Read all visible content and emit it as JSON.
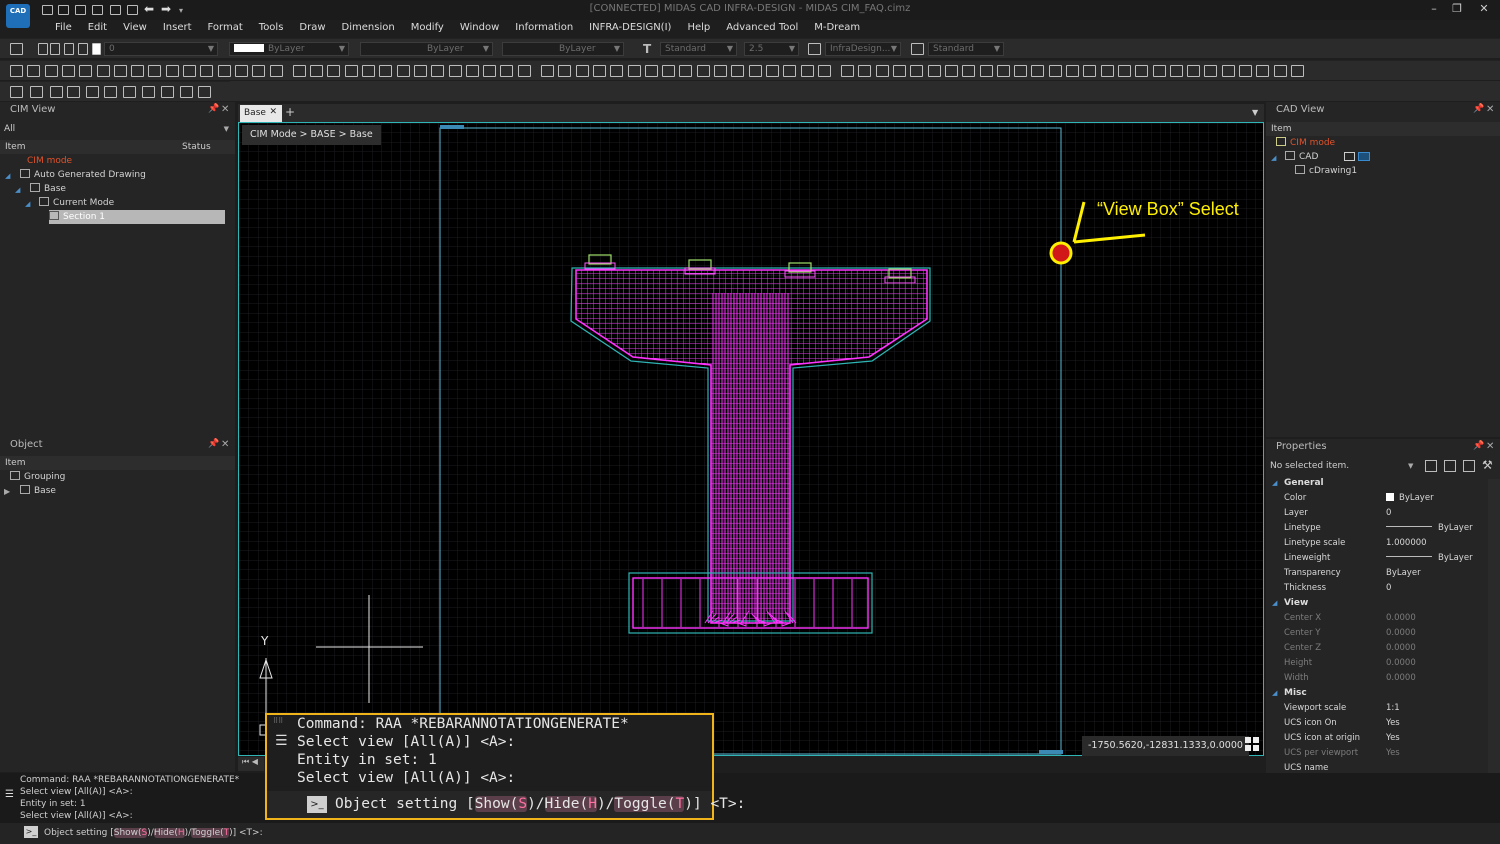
{
  "app": {
    "logo": "CAD",
    "title": "[CONNECTED] MIDAS CAD INFRA-DESIGN - MIDAS CIM_FAQ.cimz",
    "window_buttons": [
      "–",
      "❐",
      "✕"
    ]
  },
  "menu": [
    "File",
    "Edit",
    "View",
    "Insert",
    "Format",
    "Tools",
    "Draw",
    "Dimension",
    "Modify",
    "Window",
    "Information",
    "INFRA-DESIGN(I)",
    "Help",
    "Advanced Tool",
    "M-Dream"
  ],
  "layer_toolbar": {
    "layer_value": "0",
    "color_value": "ByLayer",
    "linetype_value": "ByLayer",
    "lineweight_value": "ByLayer",
    "textstyle_value": "Standard",
    "textsize_value": "2.5",
    "dimstyle_value": "InfraDesign...",
    "tablestyle_value": "Standard"
  },
  "cim_view": {
    "title": "CIM View",
    "filter_value": "All",
    "col_item": "Item",
    "col_status": "Status",
    "items": [
      {
        "label": "CIM mode",
        "color": "#e0532b"
      },
      {
        "label": "Auto Generated Drawing"
      },
      {
        "label": "Base"
      },
      {
        "label": "Current Mode"
      },
      {
        "label": "Section 1"
      }
    ]
  },
  "object_panel": {
    "title": "Object",
    "col_item": "Item",
    "items": [
      "Grouping",
      "Base"
    ]
  },
  "drawing_tabs": {
    "active": "Base",
    "add": "+"
  },
  "breadcrumb": "CIM Mode > BASE > Base",
  "annotation": {
    "text": "“View Box” Select",
    "color": "#ffef00"
  },
  "ucs": {
    "y_label": "Y"
  },
  "coordinate_readout": "-1750.5620,-12831.1333,0.0000",
  "cad_view": {
    "title": "CAD View",
    "col_item": "Item",
    "items": [
      "CIM mode",
      "CAD",
      "cDrawing1"
    ]
  },
  "properties": {
    "title": "Properties",
    "selection": "No selected item.",
    "categories": {
      "general": "General",
      "view": "View",
      "misc": "Misc"
    },
    "general": [
      {
        "k": "Color",
        "v": "ByLayer"
      },
      {
        "k": "Layer",
        "v": "0"
      },
      {
        "k": "Linetype",
        "v": "ByLayer"
      },
      {
        "k": "Linetype scale",
        "v": "1.000000"
      },
      {
        "k": "Lineweight",
        "v": "ByLayer"
      },
      {
        "k": "Transparency",
        "v": "ByLayer"
      },
      {
        "k": "Thickness",
        "v": "0"
      }
    ],
    "view": [
      {
        "k": "Center X",
        "v": "0.0000"
      },
      {
        "k": "Center Y",
        "v": "0.0000"
      },
      {
        "k": "Center Z",
        "v": "0.0000"
      },
      {
        "k": "Height",
        "v": "0.0000"
      },
      {
        "k": "Width",
        "v": "0.0000"
      }
    ],
    "misc": [
      {
        "k": "Viewport scale",
        "v": "1:1"
      },
      {
        "k": "UCS icon On",
        "v": "Yes"
      },
      {
        "k": "UCS icon at origin",
        "v": "Yes"
      },
      {
        "k": "UCS per viewport",
        "v": "Yes"
      },
      {
        "k": "UCS name",
        "v": ""
      }
    ]
  },
  "command": {
    "history": [
      "Command:  RAA *REBARANNOTATIONGENERATE*",
      "Select view [All(A)] <A>:",
      "Entity in set: 1",
      "Select view [All(A)] <A>:"
    ],
    "prompt_prefix": "Object setting [",
    "opt_show": "Show(",
    "opt_show_key": "S",
    "sep1": ")/",
    "opt_hide": "Hide(",
    "opt_hide_key": "H",
    "sep2": ")/",
    "opt_toggle": "Toggle(",
    "opt_toggle_key": "T",
    "prompt_suffix": ")] <T>:"
  }
}
